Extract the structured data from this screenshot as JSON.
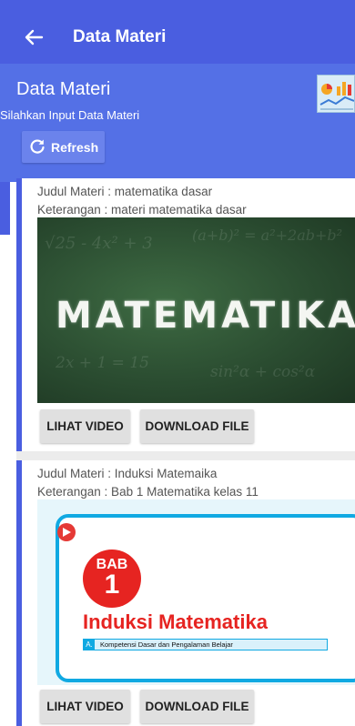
{
  "appbar": {
    "title": "Data Materi"
  },
  "header": {
    "title": "Data Materi",
    "subtitle": "Silahkan Input Data Materi",
    "refresh_label": "Refresh"
  },
  "materials": [
    {
      "judul": "Judul Materi : matematika dasar",
      "keterangan": "Keterangan : materi matematika dasar",
      "thumbnail_text": "MATEMATIKA",
      "video_label": "LIHAT VIDEO",
      "download_label": "DOWNLOAD FILE"
    },
    {
      "judul": "Judul Materi : Induksi Matemaika",
      "keterangan": "Keterangan : Bab 1 Matematika kelas 11",
      "thumbnail": {
        "bab_word": "BAB",
        "bab_number": "1",
        "title": "Induksi Matematika",
        "section_tag": "A.",
        "section_text": "Kompetensi Dasar dan Pengalaman Belajar"
      },
      "video_label": "LIHAT VIDEO",
      "download_label": "DOWNLOAD FILE"
    }
  ],
  "colors": {
    "primary": "#4a5ee0",
    "header": "#5470e6",
    "button": "#e0e0e0",
    "accent_red": "#e62421"
  }
}
